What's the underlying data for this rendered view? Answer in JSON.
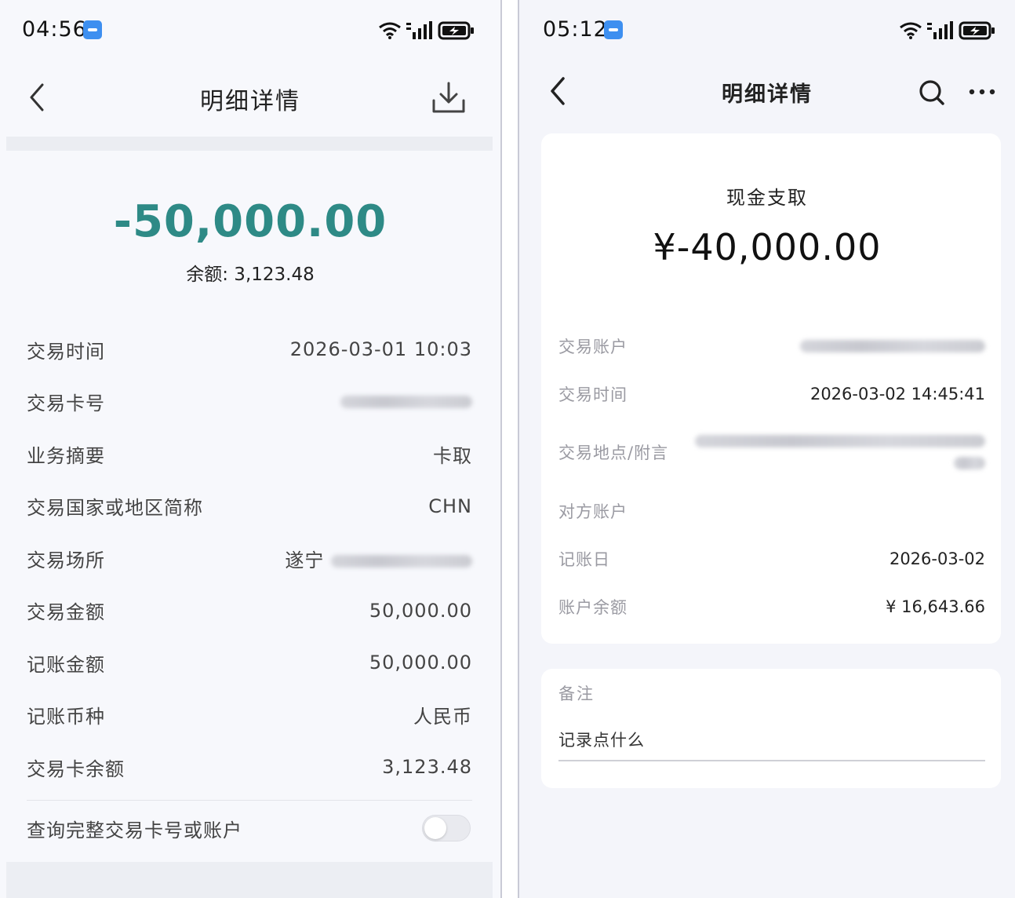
{
  "left": {
    "status_time": "04:56",
    "title": "明细详情",
    "amount": "-50,000.00",
    "balance_label": "余额: 3,123.48",
    "rows": [
      {
        "label": "交易时间",
        "value": "2026-03-01 10:03"
      },
      {
        "label": "交易卡号",
        "value": ""
      },
      {
        "label": "业务摘要",
        "value": "卡取"
      },
      {
        "label": "交易国家或地区简称",
        "value": "CHN"
      },
      {
        "label": "交易场所",
        "value": "遂宁"
      },
      {
        "label": "交易金额",
        "value": "50,000.00"
      },
      {
        "label": "记账金额",
        "value": "50,000.00"
      },
      {
        "label": "记账币种",
        "value": "人民币"
      },
      {
        "label": "交易卡余额",
        "value": "3,123.48"
      }
    ],
    "toggle_label": "查询完整交易卡号或账户",
    "toggle_on": false,
    "accent_color": "#2e8a86"
  },
  "right": {
    "status_time": "05:12",
    "title": "明细详情",
    "transaction_type": "现金支取",
    "amount": "¥-40,000.00",
    "rows": [
      {
        "label": "交易账户",
        "value": ""
      },
      {
        "label": "交易时间",
        "value": "2026-03-02 14:45:41"
      },
      {
        "label": "交易地点/附言",
        "value": ""
      },
      {
        "label": "对方账户",
        "value": ""
      },
      {
        "label": "记账日",
        "value": "2026-03-02"
      },
      {
        "label": "账户余额",
        "value": "¥ 16,643.66"
      }
    ],
    "note_label": "备注",
    "note_placeholder": "记录点什么"
  },
  "icons": {
    "back": "chevron-left-icon",
    "download": "download-icon",
    "search": "search-icon",
    "more": "more-icon",
    "wifi": "wifi-icon",
    "signal": "signal-icon",
    "battery": "battery-charging-icon"
  }
}
